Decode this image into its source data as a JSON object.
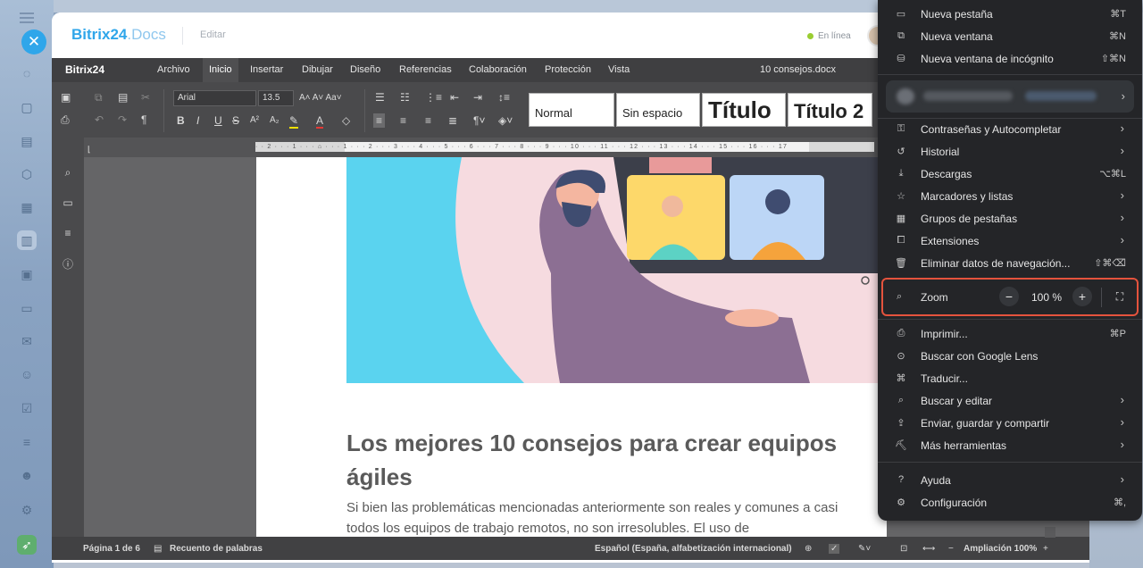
{
  "app": {
    "logo_main": "Bitrix24",
    "logo_suffix": ".Docs",
    "edit_label": "Editar",
    "status": "En línea"
  },
  "editor": {
    "brand": "Bitrix24",
    "menu": [
      "Archivo",
      "Inicio",
      "Insertar",
      "Dibujar",
      "Diseño",
      "Referencias",
      "Colaboración",
      "Protección",
      "Vista"
    ],
    "active_tab": "Inicio",
    "document_title": "10 consejos.docx",
    "font_name": "Arial",
    "font_size": "13.5",
    "styles": [
      "Normal",
      "Sin espacio",
      "Título",
      "Título 2"
    ]
  },
  "document": {
    "heading": "Los mejores 10 consejos para crear equipos ágiles",
    "body": "Si bien las problemáticas mencionadas anteriormente son reales y comunes a casi todos los equipos de trabajo remotos, no son irresolubles. El uso de"
  },
  "statusbar": {
    "page": "Página 1 de 6",
    "word_count": "Recuento de palabras",
    "language": "Español (España, alfabetización internacional)",
    "zoom": "Ampliación 100%"
  },
  "chrome_menu": {
    "group1": [
      {
        "icon": "new-tab-icon",
        "label": "Nueva pestaña",
        "shortcut": "⌘T"
      },
      {
        "icon": "new-window-icon",
        "label": "Nueva ventana",
        "shortcut": "⌘N"
      },
      {
        "icon": "incognito-icon",
        "label": "Nueva ventana de incógnito",
        "shortcut": "⇧⌘N"
      }
    ],
    "group2": [
      {
        "icon": "key-icon",
        "label": "Contraseñas y Autocompletar",
        "shortcut": "",
        "submenu": true
      },
      {
        "icon": "history-icon",
        "label": "Historial",
        "shortcut": "",
        "submenu": true
      },
      {
        "icon": "download-icon",
        "label": "Descargas",
        "shortcut": "⌥⌘L",
        "submenu": false
      },
      {
        "icon": "star-icon",
        "label": "Marcadores y listas",
        "shortcut": "",
        "submenu": true
      },
      {
        "icon": "tab-groups-icon",
        "label": "Grupos de pestañas",
        "shortcut": "",
        "submenu": true
      },
      {
        "icon": "extensions-icon",
        "label": "Extensiones",
        "shortcut": "",
        "submenu": true
      },
      {
        "icon": "trash-icon",
        "label": "Eliminar datos de navegación...",
        "shortcut": "⇧⌘⌫",
        "submenu": false
      }
    ],
    "zoom": {
      "label": "Zoom",
      "value": "100 %",
      "minus": "−",
      "plus": "+"
    },
    "group3": [
      {
        "icon": "print-icon",
        "label": "Imprimir...",
        "shortcut": "⌘P",
        "submenu": false
      },
      {
        "icon": "google-lens-icon",
        "label": "Buscar con Google Lens",
        "shortcut": "",
        "submenu": false
      },
      {
        "icon": "translate-icon",
        "label": "Traducir...",
        "shortcut": "",
        "submenu": false
      },
      {
        "icon": "find-icon",
        "label": "Buscar y editar",
        "shortcut": "",
        "submenu": true
      },
      {
        "icon": "share-icon",
        "label": "Enviar, guardar y compartir",
        "shortcut": "",
        "submenu": true
      },
      {
        "icon": "toolbox-icon",
        "label": "Más herramientas",
        "shortcut": "",
        "submenu": true
      }
    ],
    "group4": [
      {
        "icon": "help-icon",
        "label": "Ayuda",
        "shortcut": "",
        "submenu": true
      },
      {
        "icon": "settings-icon",
        "label": "Configuración",
        "shortcut": "⌘,",
        "submenu": false
      }
    ]
  }
}
